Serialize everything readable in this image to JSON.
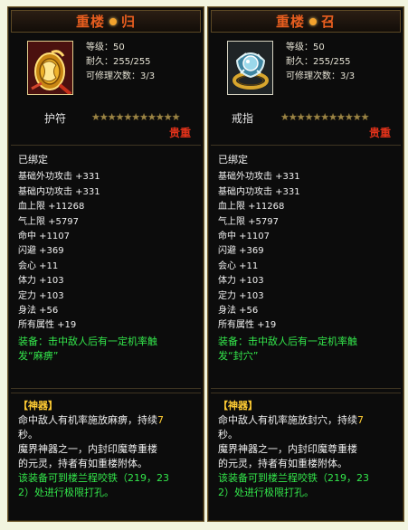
{
  "tooltips": [
    {
      "title_left": "重楼",
      "title_right": "归",
      "level": "等级：50",
      "durability": "耐久：255/255",
      "repairs": "可修理次数：3/3",
      "type": "护符",
      "stars": "★★★★★★★★★★★",
      "rarity": "贵重",
      "bound": "已绑定",
      "attributes": [
        "基础外功攻击 +331",
        "基础内功攻击 +331",
        "血上限 +11268",
        "气上限 +5797",
        "命中 +1107",
        "闪避 +369",
        "会心 +11",
        "体力 +103",
        "定力 +103",
        "身法 +56",
        "所有属性 +19"
      ],
      "set_effect_1": "装备：击中敌人后有一定机率触",
      "set_effect_2": "发“麻痹”",
      "artifact_title": "【神器】",
      "artifact_effect_1": "命中敌人有机率施放麻痹，持续",
      "artifact_effect_num": "7",
      "artifact_effect_2": "秒。",
      "lore_1": "魔界神器之一，内封印魔尊重楼",
      "lore_2": "的元灵，持者有如重楼附体。",
      "location_1": "该装备可到楼兰程咬铁（219，23",
      "location_2": "2）处进行极限打孔。",
      "icon": "amulet-icon"
    },
    {
      "title_left": "重楼",
      "title_right": "召",
      "level": "等级：50",
      "durability": "耐久：255/255",
      "repairs": "可修理次数：3/3",
      "type": "戒指",
      "stars": "★★★★★★★★★★★",
      "rarity": "贵重",
      "bound": "已绑定",
      "attributes": [
        "基础外功攻击 +331",
        "基础内功攻击 +331",
        "血上限 +11268",
        "气上限 +5797",
        "命中 +1107",
        "闪避 +369",
        "会心 +11",
        "体力 +103",
        "定力 +103",
        "身法 +56",
        "所有属性 +19"
      ],
      "set_effect_1": "装备：击中敌人后有一定机率触",
      "set_effect_2": "发“封穴”",
      "artifact_title": "【神器】",
      "artifact_effect_1": "命中敌人有机率施放封穴，持续",
      "artifact_effect_num": "7",
      "artifact_effect_2": "秒。",
      "lore_1": "魔界神器之一，内封印魔尊重楼",
      "lore_2": "的元灵，持者有如重楼附体。",
      "location_1": "该装备可到楼兰程咬铁（219，23",
      "location_2": "2）处进行极限打孔。",
      "icon": "ring-icon"
    }
  ],
  "colors": {
    "title": "#e85e1f",
    "rarity": "#e5331b",
    "green": "#33e64b",
    "artifact": "#ffcc33",
    "panel_bg": "#0c0c0c",
    "page_bg": "#f2f5df"
  }
}
